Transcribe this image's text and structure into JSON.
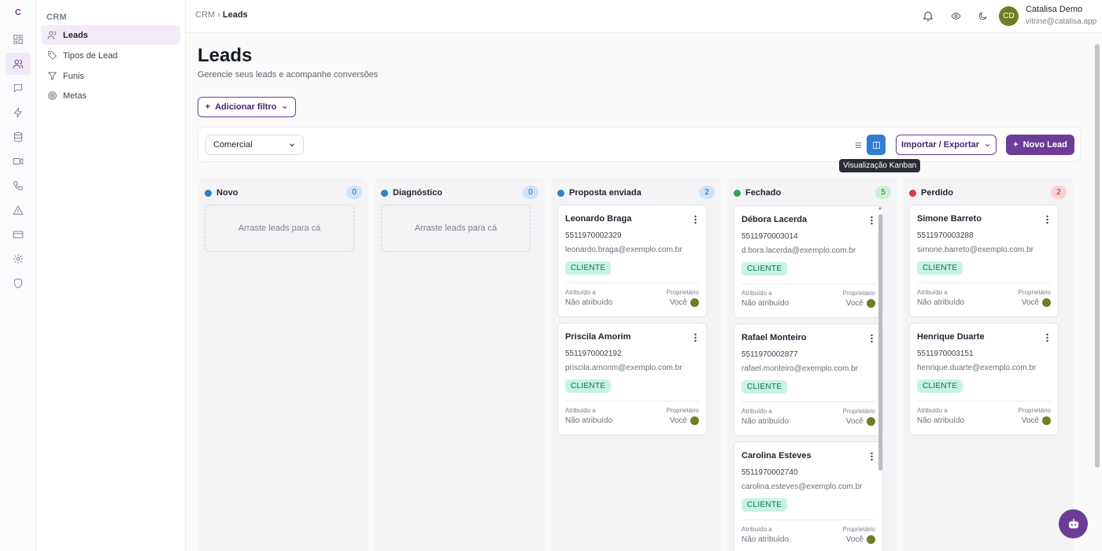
{
  "rail": {
    "logo": "C",
    "icons": [
      "dashboard-icon",
      "users-icon",
      "chat-icon",
      "zap-icon",
      "database-icon",
      "video-icon",
      "phone-icon",
      "alert-icon",
      "card-icon",
      "settings-icon",
      "shield-icon"
    ]
  },
  "sidebar": {
    "section": "CRM",
    "items": [
      {
        "label": "Leads"
      },
      {
        "label": "Tipos de Lead"
      },
      {
        "label": "Funis"
      },
      {
        "label": "Metas"
      }
    ]
  },
  "header": {
    "crumb_root": "CRM",
    "crumb_sep": "›",
    "crumb_current": "Leads",
    "user_initials": "CD",
    "user_name": "Catalisa Demo",
    "user_email": "vitrine@catalisa.app"
  },
  "page": {
    "title": "Leads",
    "subtitle": "Gerencie seus leads e acompanhe conversões",
    "filter_label": "Adicionar filtro",
    "pipeline": "Comercial",
    "import_label": "Importar / Exportar",
    "new_label": "Novo Lead",
    "tooltip": "Visualização Kanban"
  },
  "card_labels": {
    "tag": "CLIENTE",
    "assigned_label": "Atribuído a",
    "assigned_value": "Não atribuído",
    "owner_label": "Proprietário",
    "owner_value": "Você"
  },
  "columns": [
    {
      "title": "Novo",
      "count": "0",
      "color": "#2f7fd1",
      "empty": "Arraste leads para cá",
      "cards": []
    },
    {
      "title": "Diagnóstico",
      "count": "0",
      "color": "#2f7fd1",
      "empty": "Arraste leads para cá",
      "cards": []
    },
    {
      "title": "Proposta enviada",
      "count": "2",
      "color": "#2f7fd1",
      "cards": [
        {
          "name": "Leonardo Braga",
          "phone": "5511970002329",
          "email": "leonardo.braga@exemplo.com.br"
        },
        {
          "name": "Priscila Amorim",
          "phone": "5511970002192",
          "email": "priscila.amorim@exemplo.com.br"
        }
      ]
    },
    {
      "title": "Fechado",
      "count": "5",
      "color": "#2ea44f",
      "cards": [
        {
          "name": "Débora Lacerda",
          "phone": "5511970003014",
          "email": "d.bora.lacerda@exemplo.com.br"
        },
        {
          "name": "Rafael Monteiro",
          "phone": "5511970002877",
          "email": "rafael.monteiro@exemplo.com.br"
        },
        {
          "name": "Carolina Esteves",
          "phone": "5511970002740",
          "email": "carolina.esteves@exemplo.com.br"
        }
      ]
    },
    {
      "title": "Perdido",
      "count": "2",
      "color": "#e0383e",
      "cards": [
        {
          "name": "Simone Barreto",
          "phone": "5511970003288",
          "email": "simone.barreto@exemplo.com.br"
        },
        {
          "name": "Henrique Duarte",
          "phone": "5511970003151",
          "email": "henrique.duarte@exemplo.com.br"
        }
      ]
    }
  ]
}
